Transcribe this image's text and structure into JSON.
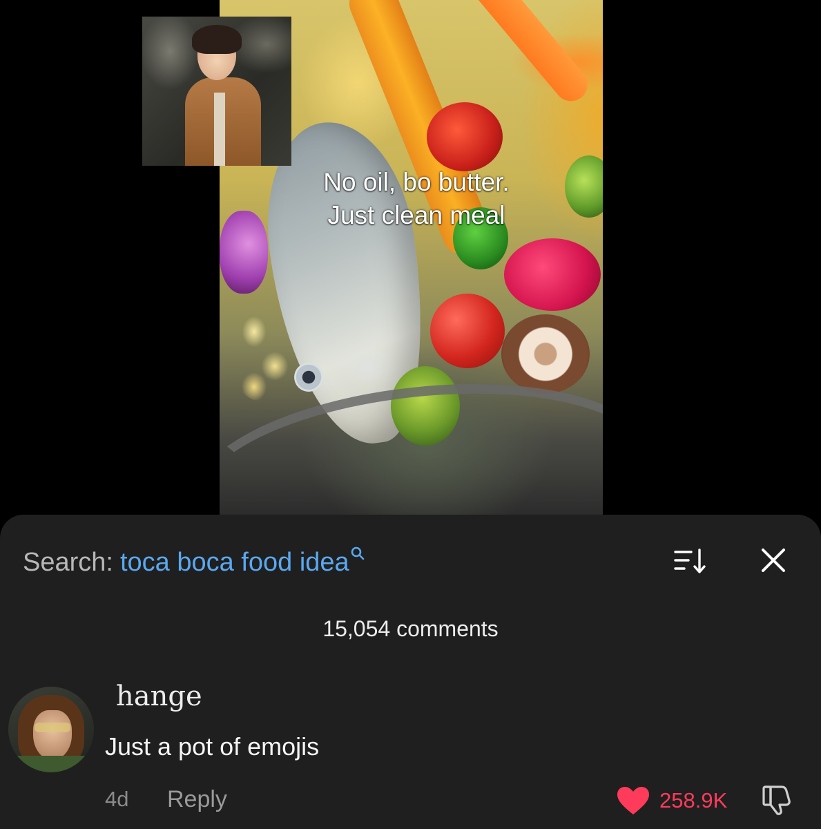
{
  "video": {
    "caption_line1": "No oil, bo butter.",
    "caption_line2": "Just clean meal"
  },
  "comments_panel": {
    "search_prefix": "Search:",
    "search_term": "toca boca food idea",
    "comment_count": "15,054 comments",
    "icons": {
      "search": "search-icon",
      "sort": "sort-icon",
      "close": "close-icon",
      "like": "heart-icon",
      "dislike": "thumbs-down-icon"
    },
    "colors": {
      "panel_bg": "#1f1f1f",
      "search_term": "#5aa8f0",
      "like": "#ff3b5c"
    }
  },
  "comment": {
    "username": "hange",
    "text": "Just a pot of emojis",
    "age": "4d",
    "reply_label": "Reply",
    "likes": "258.9K",
    "liked": true
  }
}
